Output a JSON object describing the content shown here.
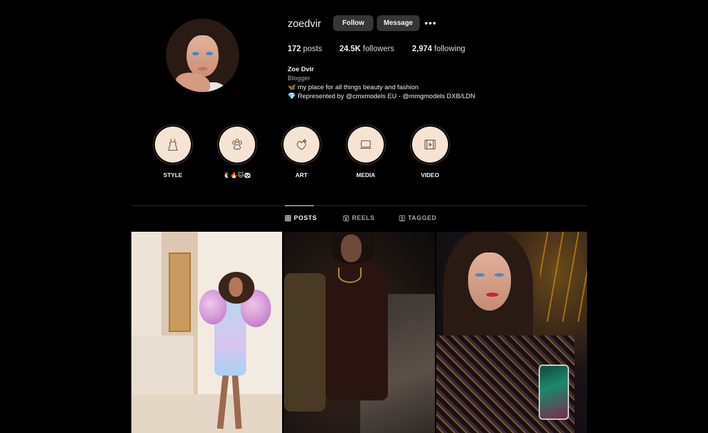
{
  "profile": {
    "username": "zoedvir",
    "follow_label": "Follow",
    "message_label": "Message",
    "more_label": "•••"
  },
  "stats": {
    "posts_count": "172",
    "posts_label": "posts",
    "followers_count": "24.5K",
    "followers_label": "followers",
    "following_count": "2,974",
    "following_label": "following"
  },
  "bio": {
    "name": "Zoe Dvir",
    "category": "Blogger",
    "line1": "🦋 my place for all things beauty and fashion",
    "line2": "💎 Represented by @cmxmodels EU - @mmgmodels DXB/LDN"
  },
  "highlights": [
    {
      "label": "STYLE",
      "icon": "dress-icon"
    },
    {
      "label": "🐧🔥🐱🐼",
      "icon": "paw-icon"
    },
    {
      "label": "ART",
      "icon": "art-icon"
    },
    {
      "label": "MEDIA",
      "icon": "laptop-icon"
    },
    {
      "label": "VIDEO",
      "icon": "film-icon"
    }
  ],
  "tabs": [
    {
      "label": "POSTS",
      "icon": "grid-icon",
      "active": true
    },
    {
      "label": "REELS",
      "icon": "reels-icon",
      "active": false
    },
    {
      "label": "TAGGED",
      "icon": "tag-icon",
      "active": false
    }
  ],
  "posts": [
    {
      "icon": "photo-pastel-dress"
    },
    {
      "icon": "photo-dark-lounge"
    },
    {
      "icon": "photo-sequin-selfie"
    }
  ],
  "colors": {
    "background": "#000000",
    "button": "#363636",
    "highlight_disc": "#f6e3d2",
    "muted_text": "#a8a8a8"
  }
}
